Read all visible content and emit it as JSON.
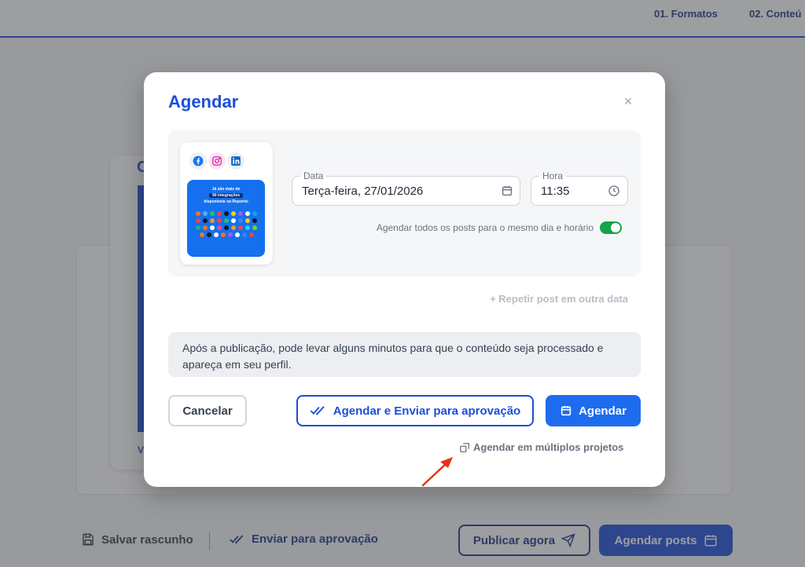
{
  "background": {
    "steps": [
      "01. Formatos",
      "02. Conteú"
    ],
    "phone_letter": "C",
    "phone_footer_letter": "V",
    "bottom_bar": {
      "save_draft": "Salvar rascunho",
      "send_for_approval": "Enviar para aprovação",
      "publish_now": "Publicar agora",
      "schedule_posts": "Agendar posts"
    }
  },
  "modal": {
    "title": "Agendar",
    "close_label": "×",
    "preview": {
      "networks": [
        "facebook-icon",
        "instagram-icon",
        "linkedin-icon"
      ],
      "image_text_1": "Já são mais de",
      "image_text_2": "90 integrações",
      "image_text_3": "disponíveis na Reportei"
    },
    "date": {
      "label": "Data",
      "value": "Terça-feira, 27/01/2026"
    },
    "time": {
      "label": "Hora",
      "value": "11:35"
    },
    "same_time_toggle": {
      "label": "Agendar todos os posts para o mesmo dia e horário",
      "on": true
    },
    "repeat_link": "+ Repetir post em outra data",
    "notice": "Após a publicação, pode levar alguns minutos para que o conteúdo seja processado e apareça em seu perfil.",
    "buttons": {
      "cancel": "Cancelar",
      "schedule_and_send": "Agendar e Enviar para aprovação",
      "schedule": "Agendar"
    },
    "multi_projects_link": "Agendar em múltiplos projetos"
  },
  "colors": {
    "primary": "#1d4ed8",
    "primary_button": "#1d6cf0",
    "toggle_on": "#16a34a",
    "annotation_arrow": "#e8321b"
  }
}
